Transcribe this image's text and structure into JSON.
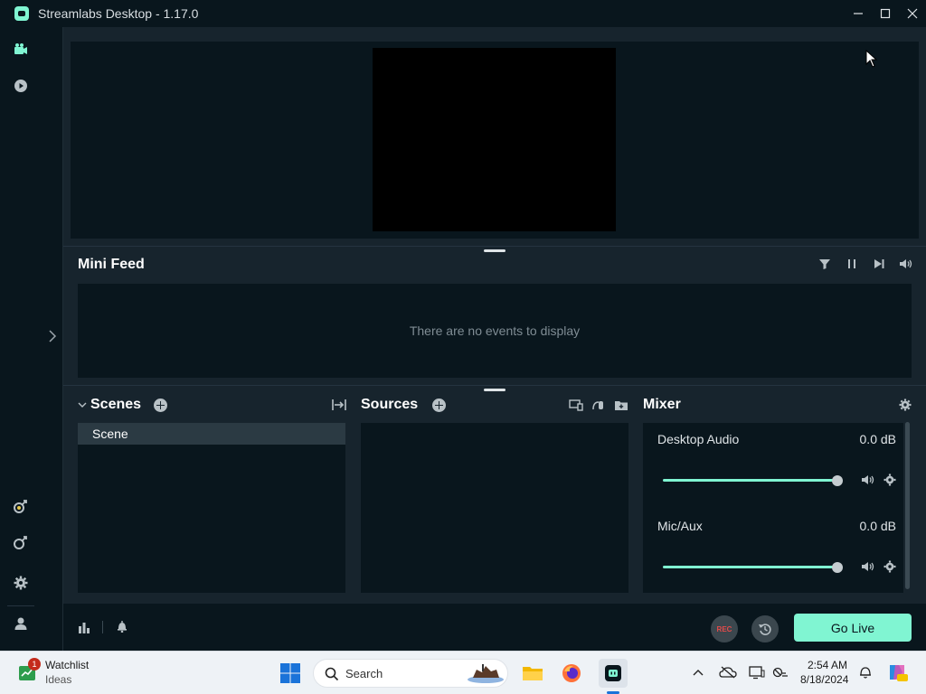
{
  "window": {
    "title": "Streamlabs Desktop - 1.17.0"
  },
  "mini_feed": {
    "title": "Mini Feed",
    "empty_text": "There are no events to display"
  },
  "scenes": {
    "title": "Scenes",
    "items": [
      "Scene"
    ]
  },
  "sources": {
    "title": "Sources"
  },
  "mixer": {
    "title": "Mixer",
    "channels": [
      {
        "name": "Desktop Audio",
        "value": "0.0 dB",
        "level": 1.0
      },
      {
        "name": "Mic/Aux",
        "value": "0.0 dB",
        "level": 1.0
      }
    ]
  },
  "footer": {
    "rec_label": "REC",
    "go_live_label": "Go Live"
  },
  "taskbar": {
    "widget_title": "Watchlist",
    "widget_subtitle": "Ideas",
    "widget_badge": "1",
    "search_placeholder": "Search",
    "time": "2:54 AM",
    "date": "8/18/2024"
  },
  "colors": {
    "accent": "#80f5d2",
    "panel": "#09161d",
    "background": "#17242d"
  }
}
